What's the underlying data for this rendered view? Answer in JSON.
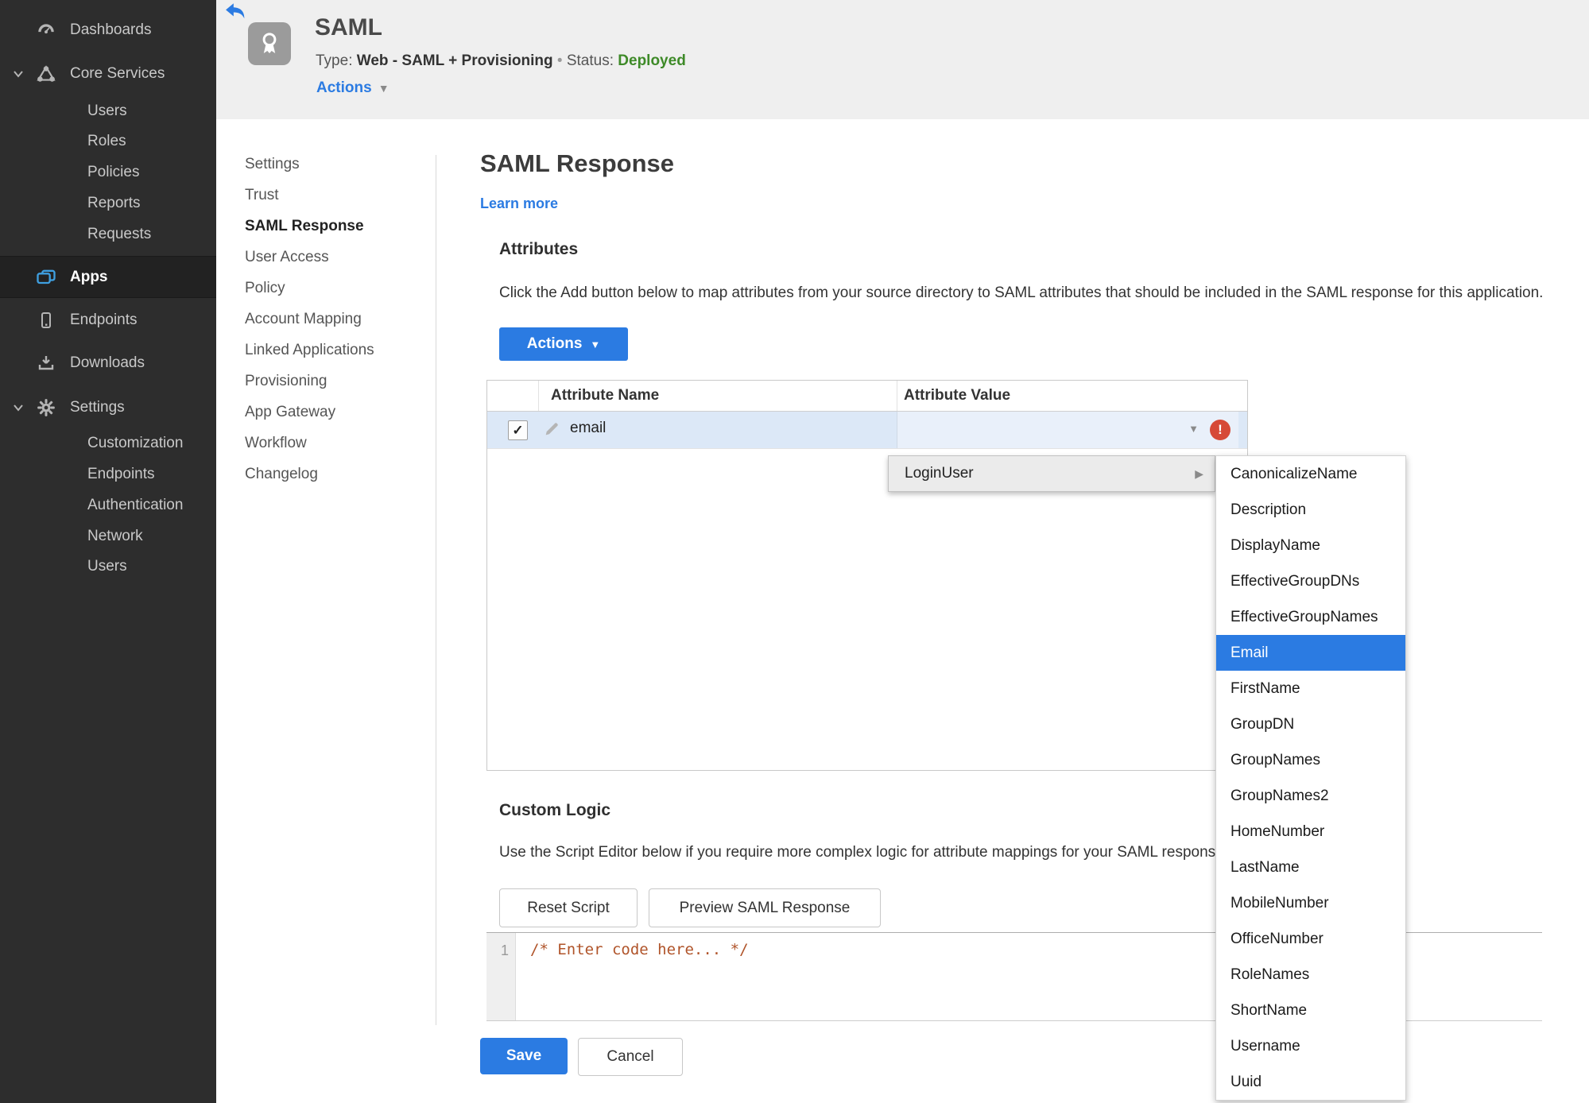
{
  "glyphs": {
    "check": "✓",
    "caret_down": "▼",
    "caret_right": "▶",
    "exclamation": "!",
    "separator": "•"
  },
  "colors": {
    "accent": "#2b7be2",
    "success": "#3e8a28",
    "error": "#d64937",
    "sidebar_bg": "#2d2d2d",
    "code": "#b0542a"
  },
  "sidebar": {
    "dashboards": "Dashboards",
    "core_services": "Core Services",
    "core_sub": [
      "Users",
      "Roles",
      "Policies",
      "Reports",
      "Requests"
    ],
    "apps": "Apps",
    "endpoints": "Endpoints",
    "downloads": "Downloads",
    "settings": "Settings",
    "settings_sub": [
      "Customization",
      "Endpoints",
      "Authentication",
      "Network",
      "Users"
    ]
  },
  "header": {
    "title": "SAML",
    "type_label": "Type:",
    "type_value": "Web - SAML + Provisioning",
    "status_label": "Status:",
    "status_value": "Deployed",
    "actions_label": "Actions"
  },
  "subnav": {
    "items": [
      "Settings",
      "Trust",
      "SAML Response",
      "User Access",
      "Policy",
      "Account Mapping",
      "Linked Applications",
      "Provisioning",
      "App Gateway",
      "Workflow",
      "Changelog"
    ],
    "active": "SAML Response"
  },
  "main": {
    "title": "SAML Response",
    "learn_more": "Learn more",
    "attributes": {
      "heading": "Attributes",
      "description": "Click the Add button below to map attributes from your source directory to SAML attributes that should be included in the SAML response for this application.",
      "actions_label": "Actions",
      "table": {
        "col_name": "Attribute Name",
        "col_value": "Attribute Value",
        "row": {
          "name": "email",
          "value": "",
          "checked": true,
          "error": true
        }
      }
    },
    "custom_logic": {
      "heading": "Custom Logic",
      "description": "Use the Script Editor below if you require more complex logic for attribute mappings for your SAML response.",
      "reset_button": "Reset Script",
      "preview_button": "Preview SAML Response",
      "editor": {
        "line_number": "1",
        "code": "/* Enter code here... */"
      }
    },
    "save_button": "Save",
    "cancel_button": "Cancel"
  },
  "menus": {
    "context_item": "LoginUser",
    "submenu": {
      "selected": "Email",
      "options": [
        "CanonicalizeName",
        "Description",
        "DisplayName",
        "EffectiveGroupDNs",
        "EffectiveGroupNames",
        "Email",
        "FirstName",
        "GroupDN",
        "GroupNames",
        "GroupNames2",
        "HomeNumber",
        "LastName",
        "MobileNumber",
        "OfficeNumber",
        "RoleNames",
        "ShortName",
        "Username",
        "Uuid"
      ]
    }
  }
}
